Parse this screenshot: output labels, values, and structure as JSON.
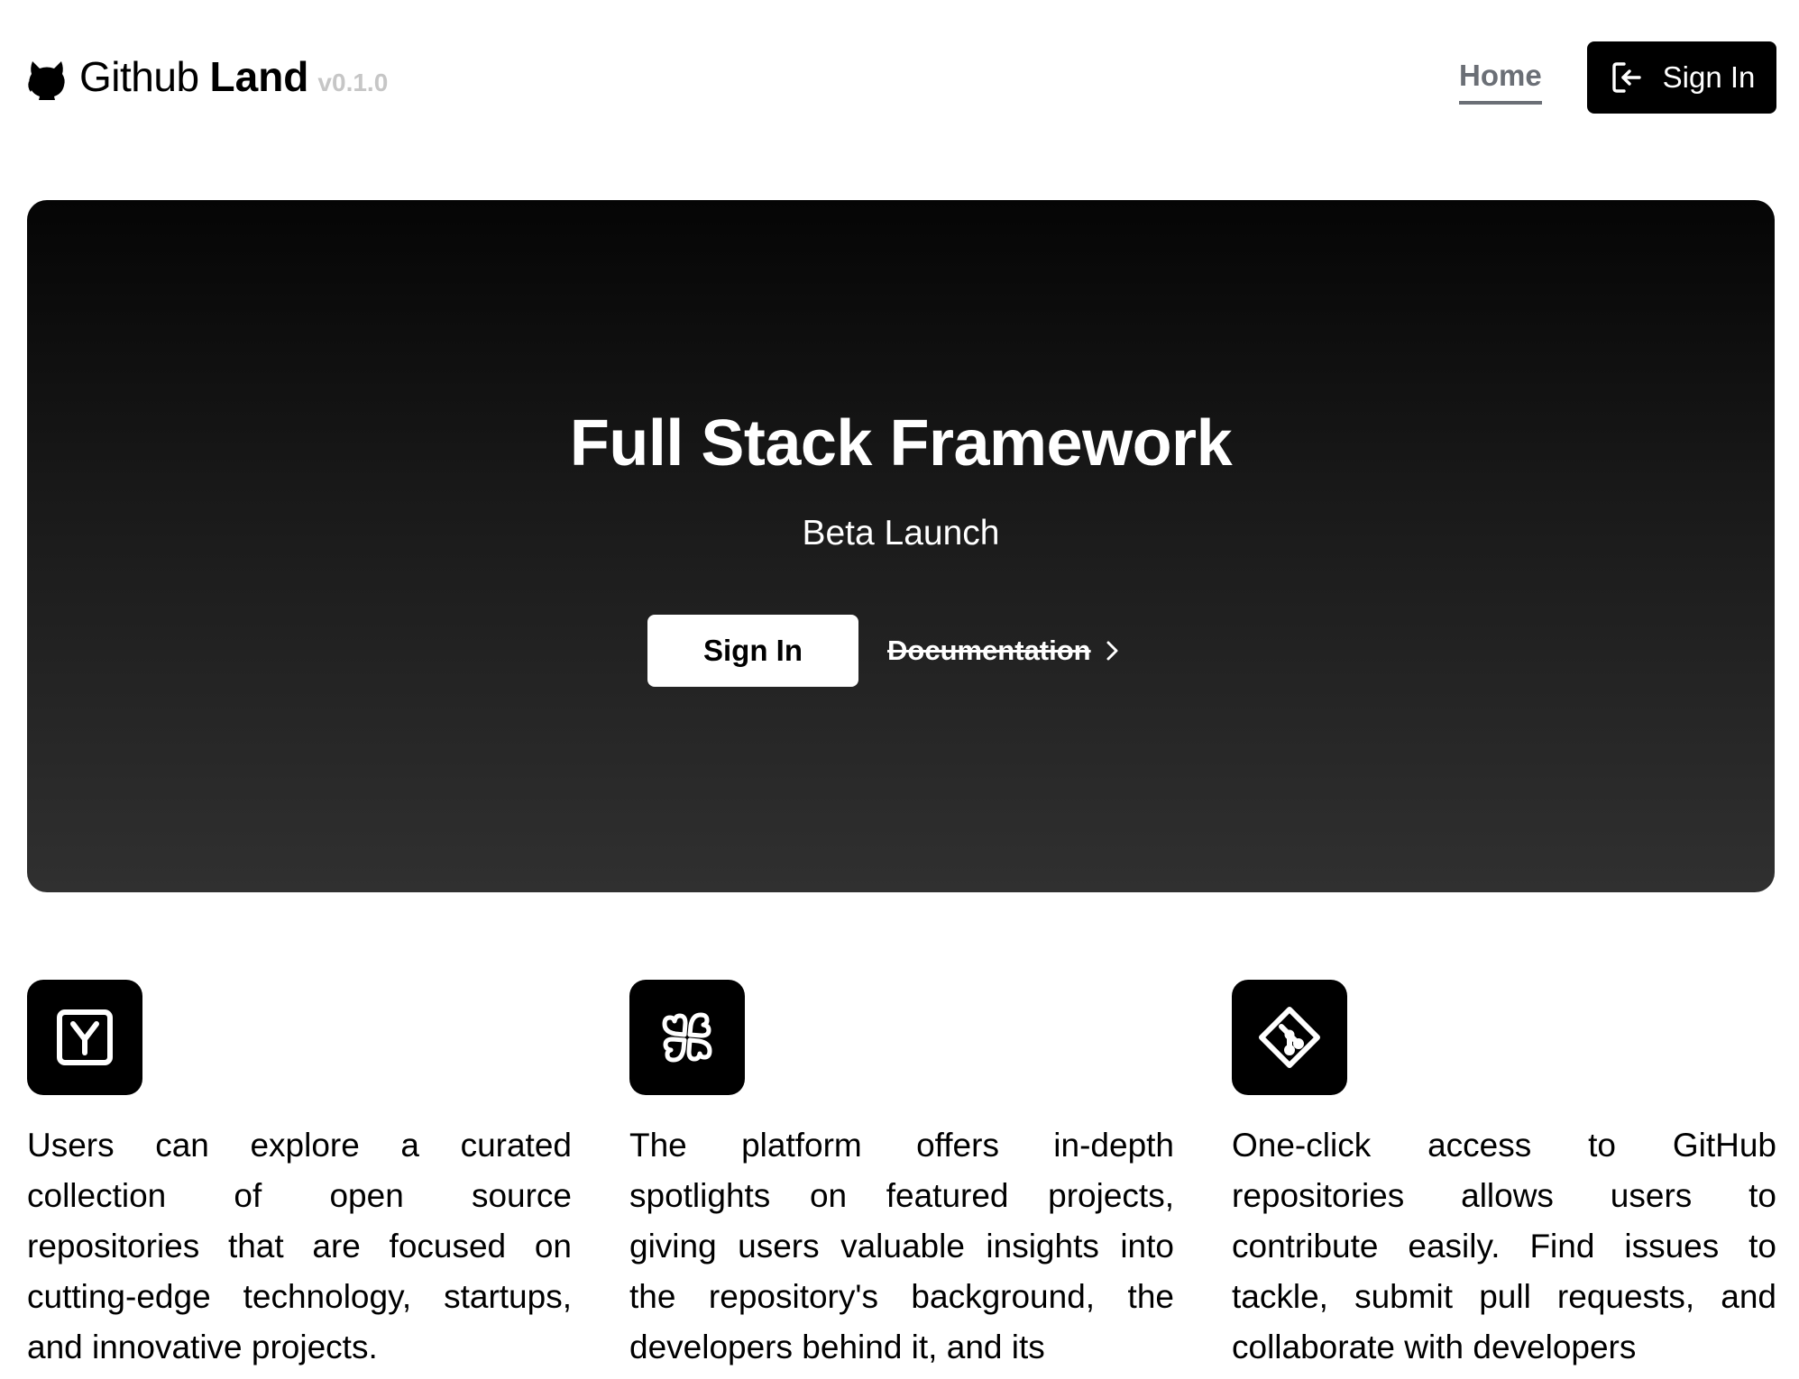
{
  "header": {
    "brand_name": "Github",
    "brand_bold": "Land",
    "brand_version": "v0.1.0",
    "brand_icon": "github-octocat-icon",
    "nav_home": "Home",
    "signin_label": "Sign In",
    "signin_icon": "login-icon"
  },
  "hero": {
    "title": "Full Stack Framework",
    "subtitle": "Beta Launch",
    "signin_label": "Sign In",
    "docs_label": "Documentation",
    "docs_icon": "chevron-right-icon"
  },
  "features": [
    {
      "icon": "y-combinator-icon",
      "text": "Users can explore a curated collection of open source repositories that are focused on cutting-edge technology, startups, and innovative projects."
    },
    {
      "icon": "clover-icon",
      "text": "The platform offers in-depth spotlights on featured projects, giving users valuable insights into the repository's background, the developers behind it, and its"
    },
    {
      "icon": "git-icon",
      "text": "One-click access to GitHub repositories allows users to contribute easily. Find issues to tackle, submit pull requests, and collaborate with developers"
    }
  ],
  "colors": {
    "accent": "#000000",
    "nav_link": "#6b6f76",
    "version_text": "#c6c6c6",
    "hero_gradient_top": "#050505",
    "hero_gradient_bottom": "#303030"
  }
}
